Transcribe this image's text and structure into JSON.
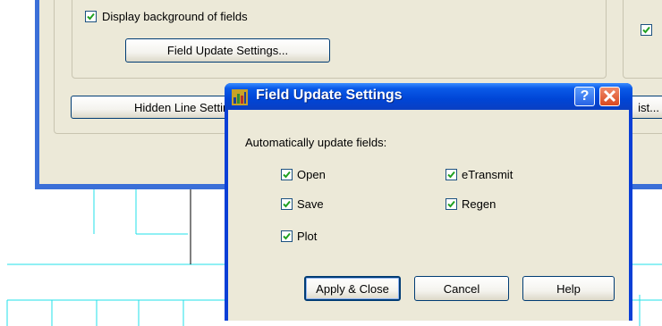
{
  "options": {
    "display_background_label": "Display background of fields",
    "field_update_settings_button": "Field Update Settings...",
    "hidden_line_settings_button": "Hidden Line Settings",
    "list_button_partial": "ist..."
  },
  "dialog": {
    "title": "Field Update Settings",
    "help_glyph": "?",
    "group_label": "Automatically update fields:",
    "checkboxes": [
      {
        "label": "Open",
        "checked": true
      },
      {
        "label": "Save",
        "checked": true
      },
      {
        "label": "Plot",
        "checked": true
      },
      {
        "label": "eTransmit",
        "checked": true
      },
      {
        "label": "Regen",
        "checked": true
      }
    ],
    "buttons": {
      "apply_close": "Apply & Close",
      "cancel": "Cancel",
      "help": "Help"
    }
  },
  "colors": {
    "window_face": "#ece9d8",
    "titlebar_blue": "#0a5ae8",
    "cad_line": "#00e5ee"
  }
}
